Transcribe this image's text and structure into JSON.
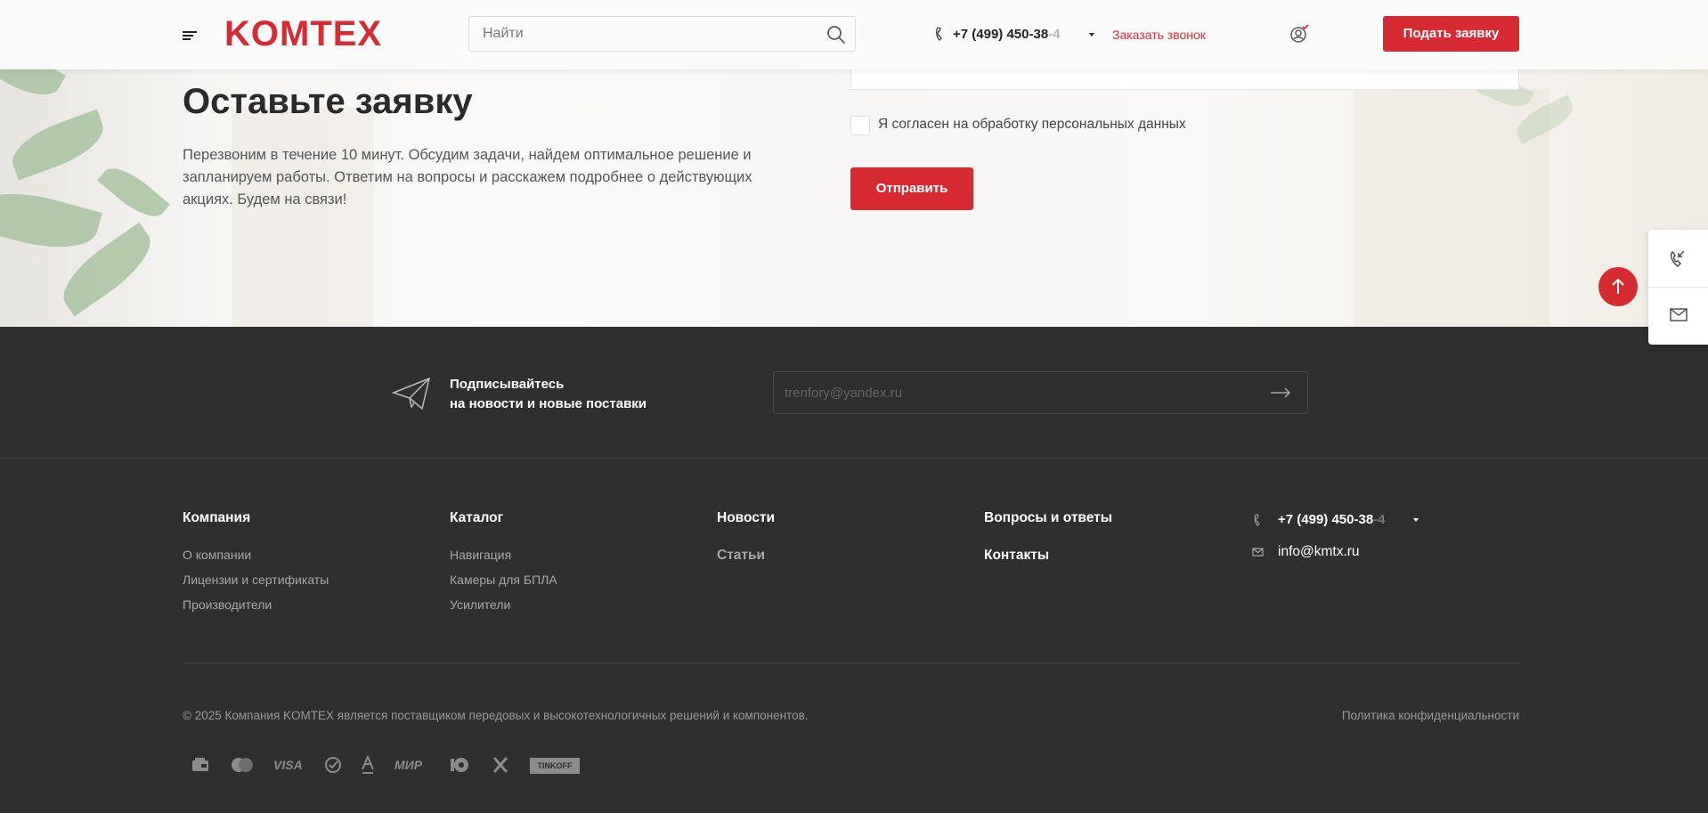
{
  "header": {
    "logo": "KOMTEX",
    "search_placeholder": "Найти",
    "phone_main": "+7 (499) 450-38",
    "phone_fade": "-4",
    "callback_label": "Заказать звонок",
    "apply_label": "Подать заявку"
  },
  "hero": {
    "title": "Оставьте заявку",
    "text": "Перезвоним в течение 10 минут. Обсудим задачи, найдем оптимальное решение и запланируем работы. Ответим на вопросы и расскажем подробнее о действующих акциях. Будем на связи!",
    "agree_label": "Я согласен на обработку персональных данных",
    "send_label": "Отправить"
  },
  "subscribe": {
    "title_line1": "Подписывайтесь",
    "title_line2": "на новости и новые поставки",
    "email_placeholder": "trenfory@yandex.ru"
  },
  "footer": {
    "col_company": {
      "title": "Компания",
      "links": [
        "О компании",
        "Лицензии и сертификаты",
        "Производители"
      ]
    },
    "col_catalog": {
      "title": "Каталог",
      "links": [
        "Навигация",
        "Камеры для БПЛА",
        "Усилители"
      ]
    },
    "col_news": {
      "title": "Новости",
      "sub": "Статьи"
    },
    "col_faq": {
      "title": "Вопросы и ответы",
      "sub": "Контакты"
    },
    "phone_main": "+7 (499) 450-38",
    "phone_fade": "-4",
    "email": "info@kmtx.ru",
    "copyright": "© 2025 Компания KOMTEX является поставщиком передовых и высокотехнологичных решений и компонентов.",
    "policy": "Политика конфиденциальности",
    "payments": {
      "visa": "VISA",
      "mir": "МИР",
      "tinkoff": "TINKOFF"
    }
  },
  "colors": {
    "accent": "#d62b32",
    "footer_bg": "#2f2f2f"
  }
}
